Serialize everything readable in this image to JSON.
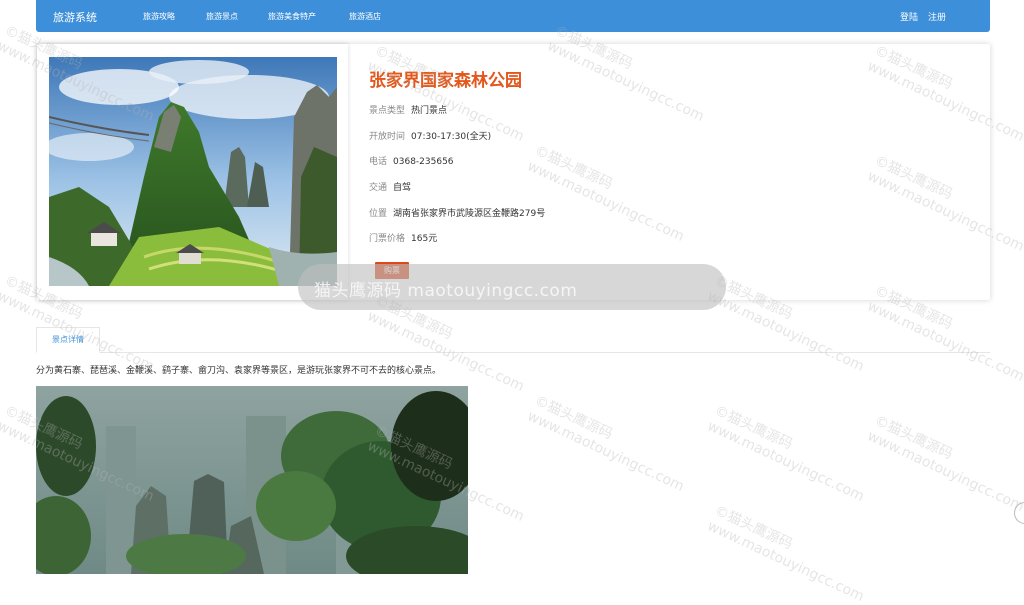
{
  "navbar": {
    "brand": "旅游系统",
    "links": [
      "旅游攻略",
      "旅游景点",
      "旅游美食特产",
      "旅游酒店"
    ],
    "login": "登陆",
    "register": "注册"
  },
  "attraction": {
    "name": "张家界国家森林公园",
    "fields": [
      {
        "label": "景点类型",
        "value": "热门景点"
      },
      {
        "label": "开放时间",
        "value": "07:30-17:30(全天)"
      },
      {
        "label": "电话",
        "value": "0368-235656"
      },
      {
        "label": "交通",
        "value": "自驾"
      },
      {
        "label": "位置",
        "value": "湖南省张家界市武陵源区金鞭路279号"
      },
      {
        "label": "门票价格",
        "value": "165元"
      }
    ],
    "buy_label": "购票"
  },
  "overlay": {
    "text": "猫头鹰源码 maotouyingcc.com"
  },
  "tabs": {
    "detail": "景点详情"
  },
  "detail": {
    "description": "分为黄石寨、琵琶溪、金鞭溪、鹞子寨、畲刀沟、袁家界等景区，是游玩张家界不可不去的核心景点。"
  },
  "watermark": {
    "line1": "©猫头鹰源码",
    "line2": "www.maotouyingcc.com"
  },
  "colors": {
    "nav": "#3d8fd9",
    "title": "#e4571b",
    "button": "#d9481e"
  }
}
